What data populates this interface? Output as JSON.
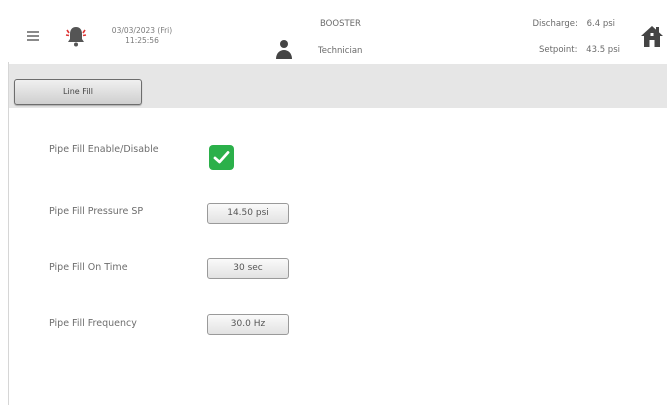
{
  "header": {
    "date": "03/03/2023 (Fri)",
    "time": "11:25:56",
    "mode": "BOOSTER",
    "role": "Technician",
    "discharge_label": "Discharge:",
    "discharge_value": "6.4 psi",
    "setpoint_label": "Setpoint:",
    "setpoint_value": "43.5 psi",
    "icons": [
      "menu-icon",
      "bell-icon",
      "person-icon",
      "home-icon"
    ]
  },
  "tabs": [
    {
      "label": "Line Fill"
    }
  ],
  "settings": {
    "enable_label": "Pipe Fill Enable/Disable",
    "enable_checked": true,
    "pressure_label": "Pipe Fill Pressure SP",
    "pressure_value": "14.50 psi",
    "ontime_label": "Pipe Fill On Time",
    "ontime_value": "30 sec",
    "frequency_label": "Pipe Fill Frequency",
    "frequency_value": "30.0 Hz"
  },
  "colors": {
    "check_green": "#2bb04a",
    "tabbar_gray": "#e6e6e6"
  }
}
